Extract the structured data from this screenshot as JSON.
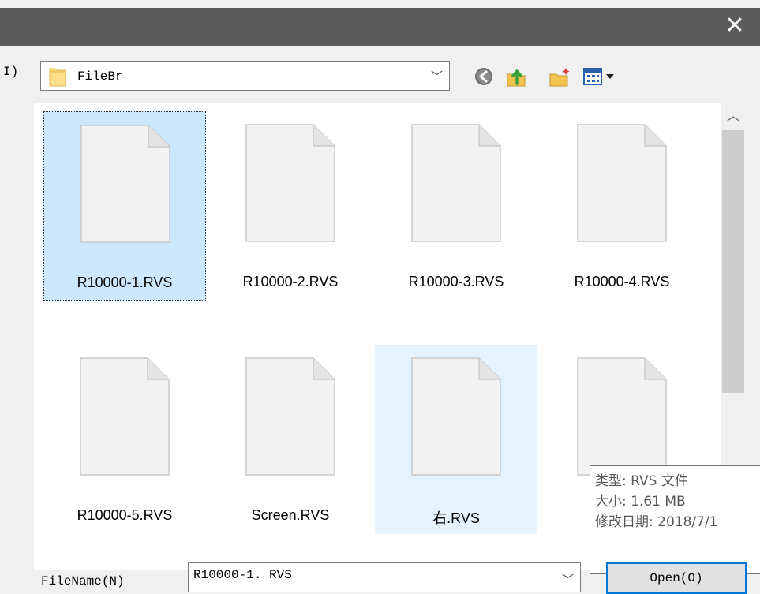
{
  "titlebar": {
    "close_glyph": "✕"
  },
  "lookin": {
    "label_fragment": "I)",
    "path": "FileBr",
    "folder_icon": "folder-icon"
  },
  "toolbar": {
    "back_icon": "back-icon",
    "up_icon": "up-folder-icon",
    "new_folder_icon": "new-folder-icon",
    "view_icon": "view-menu-icon"
  },
  "files": [
    {
      "name": "R10000-1.RVS",
      "state": "selected"
    },
    {
      "name": "R10000-2.RVS",
      "state": "normal"
    },
    {
      "name": "R10000-3.RVS",
      "state": "normal"
    },
    {
      "name": "R10000-4.RVS",
      "state": "normal"
    },
    {
      "name": "R10000-5.RVS",
      "state": "normal"
    },
    {
      "name": "Screen.RVS",
      "state": "normal"
    },
    {
      "name": "右.RVS",
      "state": "hover"
    },
    {
      "name": "",
      "state": "normal"
    }
  ],
  "tooltip": {
    "type": "类型: RVS 文件",
    "size": "大小: 1.61 MB",
    "modified": "修改日期: 2018/7/1"
  },
  "filename": {
    "label": "FileName(N)",
    "value": "R10000-1. RVS"
  },
  "buttons": {
    "open": "Open(O)"
  },
  "colors": {
    "titlebar": "#5b5b5b",
    "selection": "#cce8ff",
    "hover": "#e5f3ff",
    "accent": "#0078d7"
  }
}
